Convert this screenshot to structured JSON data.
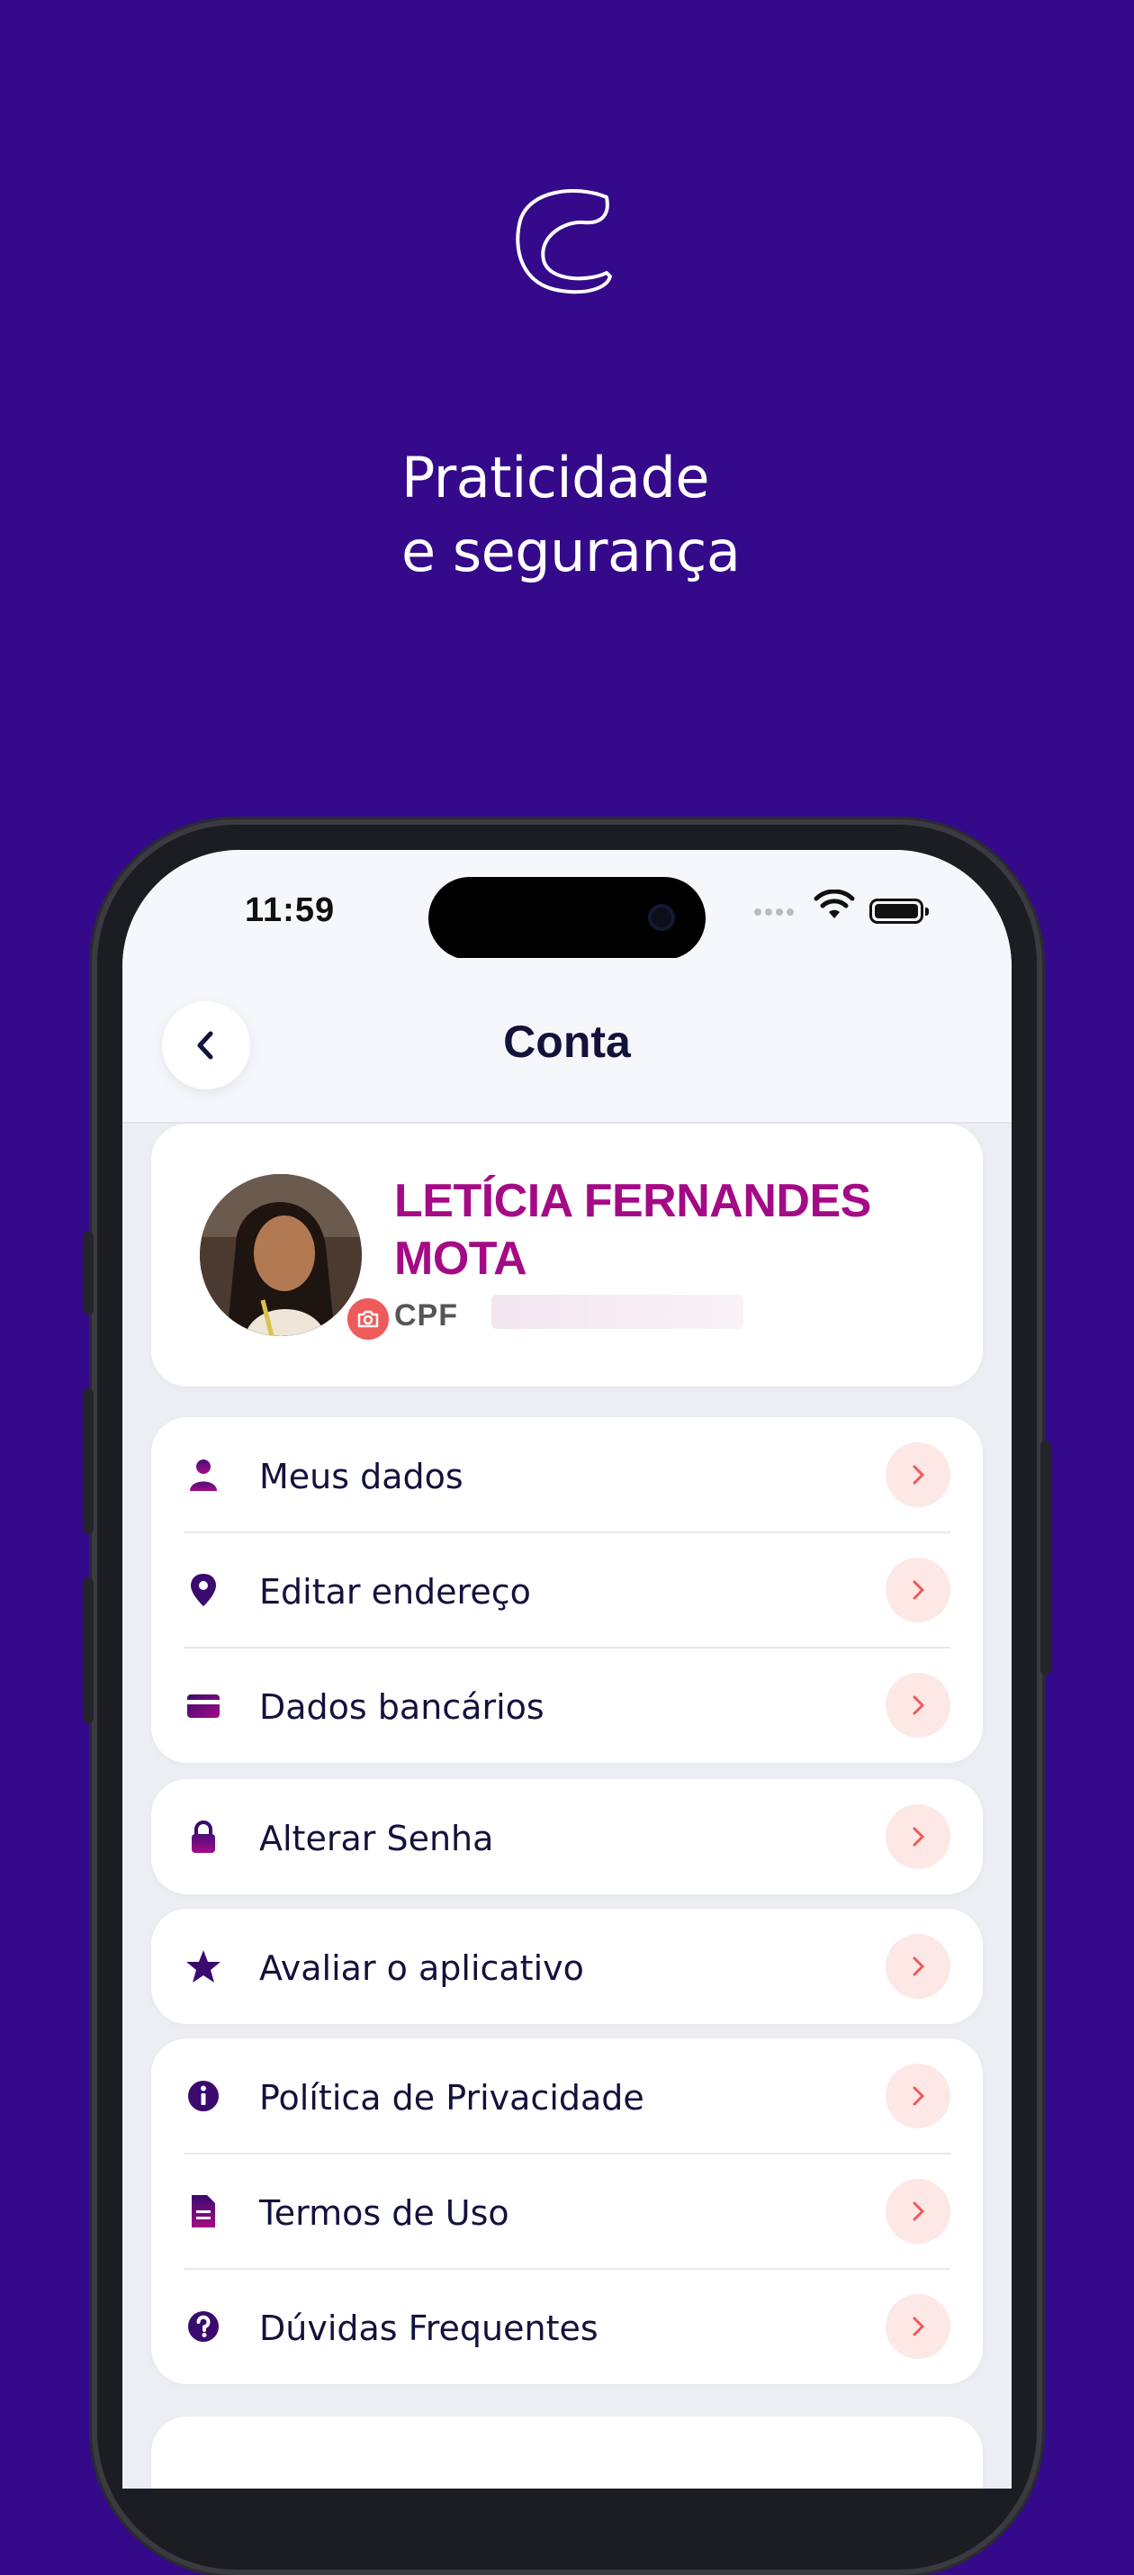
{
  "tagline": {
    "line1": "Praticidade",
    "line2": "e segurança"
  },
  "status_bar": {
    "time": "11:59"
  },
  "header": {
    "title": "Conta"
  },
  "profile": {
    "name": "LETÍCIA FERNANDES MOTA",
    "cpf_label": "CPF"
  },
  "menu_groups": [
    [
      {
        "label": "Meus dados",
        "icon": "person-icon"
      },
      {
        "label": "Editar endereço",
        "icon": "location-pin-icon"
      },
      {
        "label": "Dados bancários",
        "icon": "card-icon"
      }
    ],
    [
      {
        "label": "Alterar Senha",
        "icon": "lock-icon"
      }
    ],
    [
      {
        "label": "Avaliar o aplicativo",
        "icon": "star-icon"
      }
    ],
    [
      {
        "label": "Política de Privacidade",
        "icon": "info-icon"
      },
      {
        "label": "Termos de Uso",
        "icon": "document-icon"
      },
      {
        "label": "Dúvidas Frequentes",
        "icon": "question-icon"
      }
    ]
  ],
  "colors": {
    "background": "#34098a",
    "accent": "#a50a86",
    "chevron_bg": "#fde8e6",
    "chevron": "#ef5a5a",
    "icon": "#3a0a6e"
  }
}
